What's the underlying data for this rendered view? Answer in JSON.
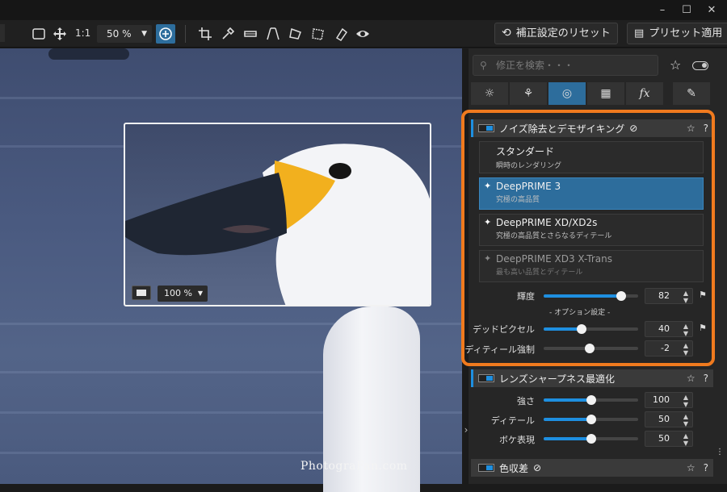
{
  "window": {
    "minimize": "–",
    "maximize": "☐",
    "close": "✕"
  },
  "toolbar": {
    "ratio_label": "1:1",
    "zoom_value": "50 %",
    "reset_button": "補正設定のリセット",
    "apply_preset_button": "プリセット適用",
    "icons": [
      "frame-icon",
      "move-icon",
      "zoom-in-icon",
      "crop-icon",
      "eyedropper-icon",
      "horizon-icon",
      "perspective-icon",
      "volume-icon",
      "shape-icon",
      "eraser-icon",
      "eye-icon"
    ]
  },
  "viewer": {
    "loupe_zoom": "100 %",
    "watermark": "PhotograFan.com"
  },
  "panel": {
    "search_placeholder": "修正を検索・・・",
    "tabs": [
      "light",
      "color",
      "detail",
      "geometry",
      "fx",
      "local"
    ],
    "active_tab": "detail",
    "noise": {
      "title": "ノイズ除去とデモザイキング",
      "options": [
        {
          "title": "スタンダード",
          "sub": "瞬時のレンダリング",
          "star": false,
          "selected": false,
          "dim": false
        },
        {
          "title": "DeepPRIME 3",
          "sub": "究極の高品質",
          "star": true,
          "selected": true,
          "dim": false
        },
        {
          "title": "DeepPRIME XD/XD2s",
          "sub": "究極の高品質とさらなるディテール",
          "star": true,
          "selected": false,
          "dim": false
        },
        {
          "title": "DeepPRIME XD3 X-Trans",
          "sub": "最も高い品質とディテール",
          "star": true,
          "selected": false,
          "dim": true
        }
      ],
      "luminance_label": "輝度",
      "luminance_value": "82",
      "luminance_level": 0.82,
      "options_header": "- オプション設定 -",
      "dead_pixel_label": "デッドピクセル",
      "dead_pixel_value": "40",
      "dead_pixel_level": 0.4,
      "detail_label": "ディティール強制",
      "detail_value": "-2",
      "detail_level": 0.49
    },
    "sharpness": {
      "title": "レンズシャープネス最適化",
      "strength_label": "強さ",
      "strength_value": "100",
      "strength_level": 0.5,
      "detail_label": "ディテール",
      "detail_value": "50",
      "detail_level": 0.5,
      "bokeh_label": "ボケ表現",
      "bokeh_value": "50",
      "bokeh_level": 0.5
    },
    "chroma": {
      "title": "色収差"
    }
  },
  "colors": {
    "accent": "#1e8fe0",
    "selected": "#2d6d9c",
    "highlight": "#f07a1e"
  }
}
